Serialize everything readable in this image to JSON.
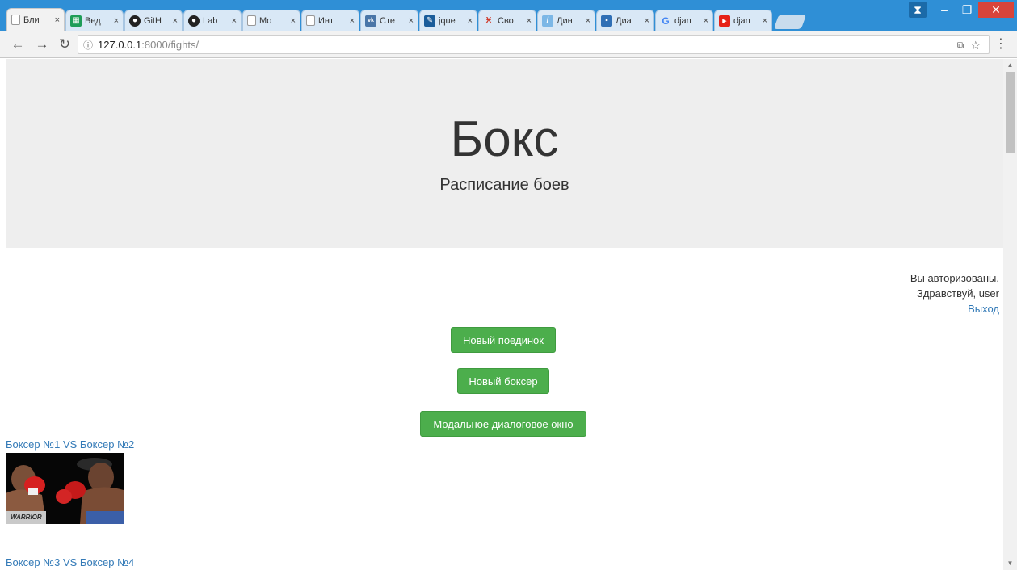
{
  "browser": {
    "tabs": [
      {
        "title": "Бли",
        "icon": "page-icon",
        "active": true
      },
      {
        "title": "Вед",
        "icon": "sheets-icon"
      },
      {
        "title": "GitH",
        "icon": "github-icon"
      },
      {
        "title": "Lab",
        "icon": "github-icon"
      },
      {
        "title": "Мо",
        "icon": "page-icon"
      },
      {
        "title": "Инт",
        "icon": "page-icon"
      },
      {
        "title": "Сте",
        "icon": "vk-icon"
      },
      {
        "title": "jque",
        "icon": "jquery-icon"
      },
      {
        "title": "Сво",
        "icon": "figure-icon"
      },
      {
        "title": "Дин",
        "icon": "doc-icon"
      },
      {
        "title": "Диа",
        "icon": "chat-icon"
      },
      {
        "title": "djan",
        "icon": "google-icon"
      },
      {
        "title": "djan",
        "icon": "youtube-icon"
      }
    ],
    "tab_close": "×",
    "url_host": "127.0.0.1",
    "url_path": ":8000/fights/"
  },
  "page": {
    "title": "Бокс",
    "subtitle": "Расписание боев",
    "auth": {
      "line1": "Вы авторизованы.",
      "line2": "Здравствуй, user",
      "logout": "Выход"
    },
    "buttons": {
      "new_fight": "Новый поединок",
      "new_boxer": "Новый боксер",
      "modal": "Модальное диалоговое окно"
    },
    "fights": [
      {
        "label": "Боксер №1 VS Боксер №2",
        "photo_text": "WARRIOR"
      },
      {
        "label": "Боксер №3 VS Боксер №4"
      }
    ]
  },
  "colors": {
    "link": "#337ab7",
    "button_green": "#4cae4c",
    "jumbotron": "#eeeeee",
    "titlebar": "#2f8fd6"
  }
}
